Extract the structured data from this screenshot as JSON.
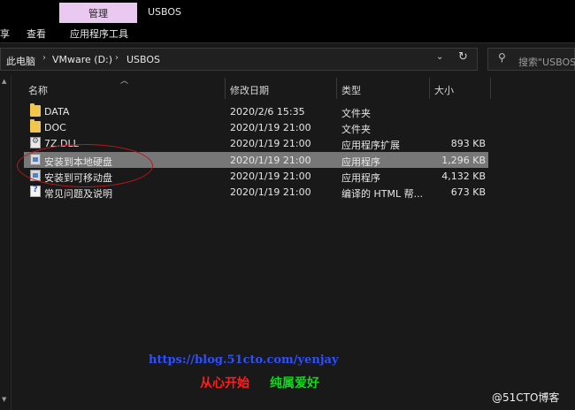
{
  "ribbon": {
    "manage_tab": "管理",
    "window_title": "USBOS",
    "left_tab_partial": "享",
    "view_tab": "查看",
    "app_tools_tab": "应用程序工具"
  },
  "address": {
    "crumbs": [
      "此电脑",
      "VMware (D:)",
      "USBOS"
    ],
    "search_placeholder": "搜索\"USBOS\""
  },
  "columns": [
    "名称",
    "修改日期",
    "类型",
    "大小"
  ],
  "files": [
    {
      "name": "DATA",
      "date": "2020/2/6 15:35",
      "type": "文件夹",
      "size": "",
      "icon": "folder-icon"
    },
    {
      "name": "DOC",
      "date": "2020/1/19 21:00",
      "type": "文件夹",
      "size": "",
      "icon": "folder-icon"
    },
    {
      "name": "7Z.DLL",
      "date": "2020/1/19 21:00",
      "type": "应用程序扩展",
      "size": "893 KB",
      "icon": "dll-file-icon"
    },
    {
      "name": "安装到本地硬盘",
      "date": "2020/1/19 21:00",
      "type": "应用程序",
      "size": "1,296 KB",
      "icon": "exe-file-icon"
    },
    {
      "name": "安装到可移动盘",
      "date": "2020/1/19 21:00",
      "type": "应用程序",
      "size": "4,132 KB",
      "icon": "exe-file-icon"
    },
    {
      "name": "常见问题及说明",
      "date": "2020/1/19 21:00",
      "type": "编译的 HTML 帮...",
      "size": "673 KB",
      "icon": "chm-file-icon"
    }
  ],
  "selected_index": 3,
  "watermark": {
    "url": "https://blog.51cto.com/yenjay",
    "slogan_red": "从心开始",
    "slogan_green": "纯属爱好",
    "site": "@51CTO博客"
  }
}
